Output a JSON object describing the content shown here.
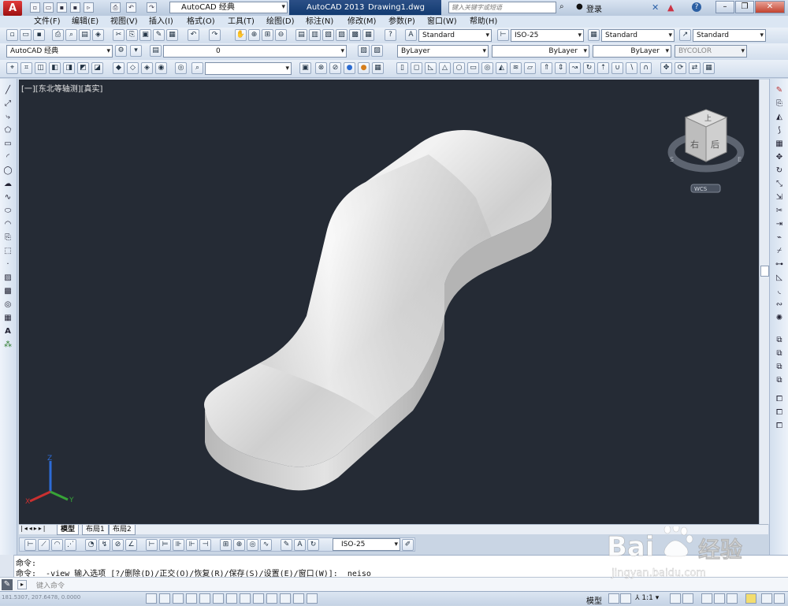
{
  "titlebar": {
    "logo": "A",
    "workspace": "AutoCAD 经典",
    "app_name": "AutoCAD 2013",
    "file_name": "Drawing1.dwg",
    "search_placeholder": "键入关键字或短语",
    "login": "登录",
    "help": "?"
  },
  "menu": [
    "文件(F)",
    "编辑(E)",
    "视图(V)",
    "插入(I)",
    "格式(O)",
    "工具(T)",
    "绘图(D)",
    "标注(N)",
    "修改(M)",
    "参数(P)",
    "窗口(W)",
    "帮助(H)"
  ],
  "toolbar2": {
    "text_style": "Standard",
    "dim_style": "ISO-25",
    "table_style": "Standard",
    "mleader_style": "Standard"
  },
  "toolbar3": {
    "workspace": "AutoCAD 经典",
    "layer": "0",
    "color": "ByLayer",
    "linetype": "ByLayer",
    "lineweight": "ByLayer",
    "plotstyle": "BYCOLOR"
  },
  "viewport": {
    "label": "[一][东北等轴测][真实]",
    "viewcube_top": "上",
    "viewcube_left": "右",
    "viewcube_right": "后",
    "wcs": "WCS",
    "axis_x": "X",
    "axis_y": "Y",
    "axis_z": "Z",
    "model_color": "#c9c9c9",
    "background_color": "#252b35"
  },
  "tabs": [
    "模型",
    "布局1",
    "布局2"
  ],
  "dimbar": {
    "dim_style": "ISO-25"
  },
  "command": {
    "line1": "命令:",
    "line2": "命令: _-view 输入选项 [?/删除(D)/正交(O)/恢复(R)/保存(S)/设置(E)/窗口(W)]: _neiso",
    "prompt": "键入命令",
    "coords": "181.5307, 207.6478, 0.0000"
  },
  "status": {
    "model": "模型",
    "scale": "1:1"
  },
  "watermark": {
    "brand": "Bai",
    "brand2": "经验",
    "url": "jingyan.baidu.com"
  }
}
